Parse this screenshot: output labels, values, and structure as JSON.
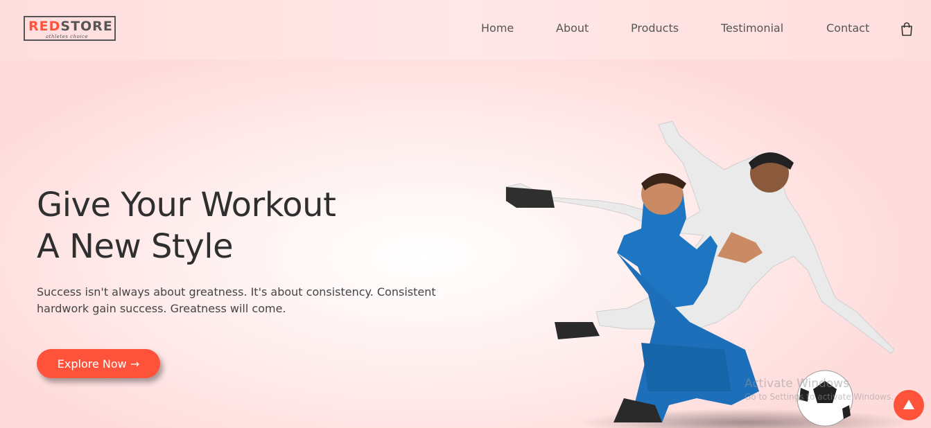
{
  "brand": {
    "logo_red": "RED",
    "logo_dark": "STORE",
    "tagline": "athletes choice",
    "accent_color": "#ff523b"
  },
  "nav": {
    "items": [
      {
        "label": "Home"
      },
      {
        "label": "About"
      },
      {
        "label": "Products"
      },
      {
        "label": "Testimonial"
      },
      {
        "label": "Contact"
      }
    ],
    "cart_icon": "shopping-bag-icon"
  },
  "hero": {
    "title_line1": "Give Your Workout",
    "title_line2": "A New Style",
    "description": "Success isn't always about greatness. It's about consistency. Consistent hardwork gain success. Greatness will come.",
    "cta_label": "Explore Now →",
    "image": "football-players-illustration"
  },
  "watermark": {
    "title": "Activate Windows",
    "subtitle": "Go to Settings to activate Windows."
  },
  "scroll_top_icon": "arrow-up-icon"
}
